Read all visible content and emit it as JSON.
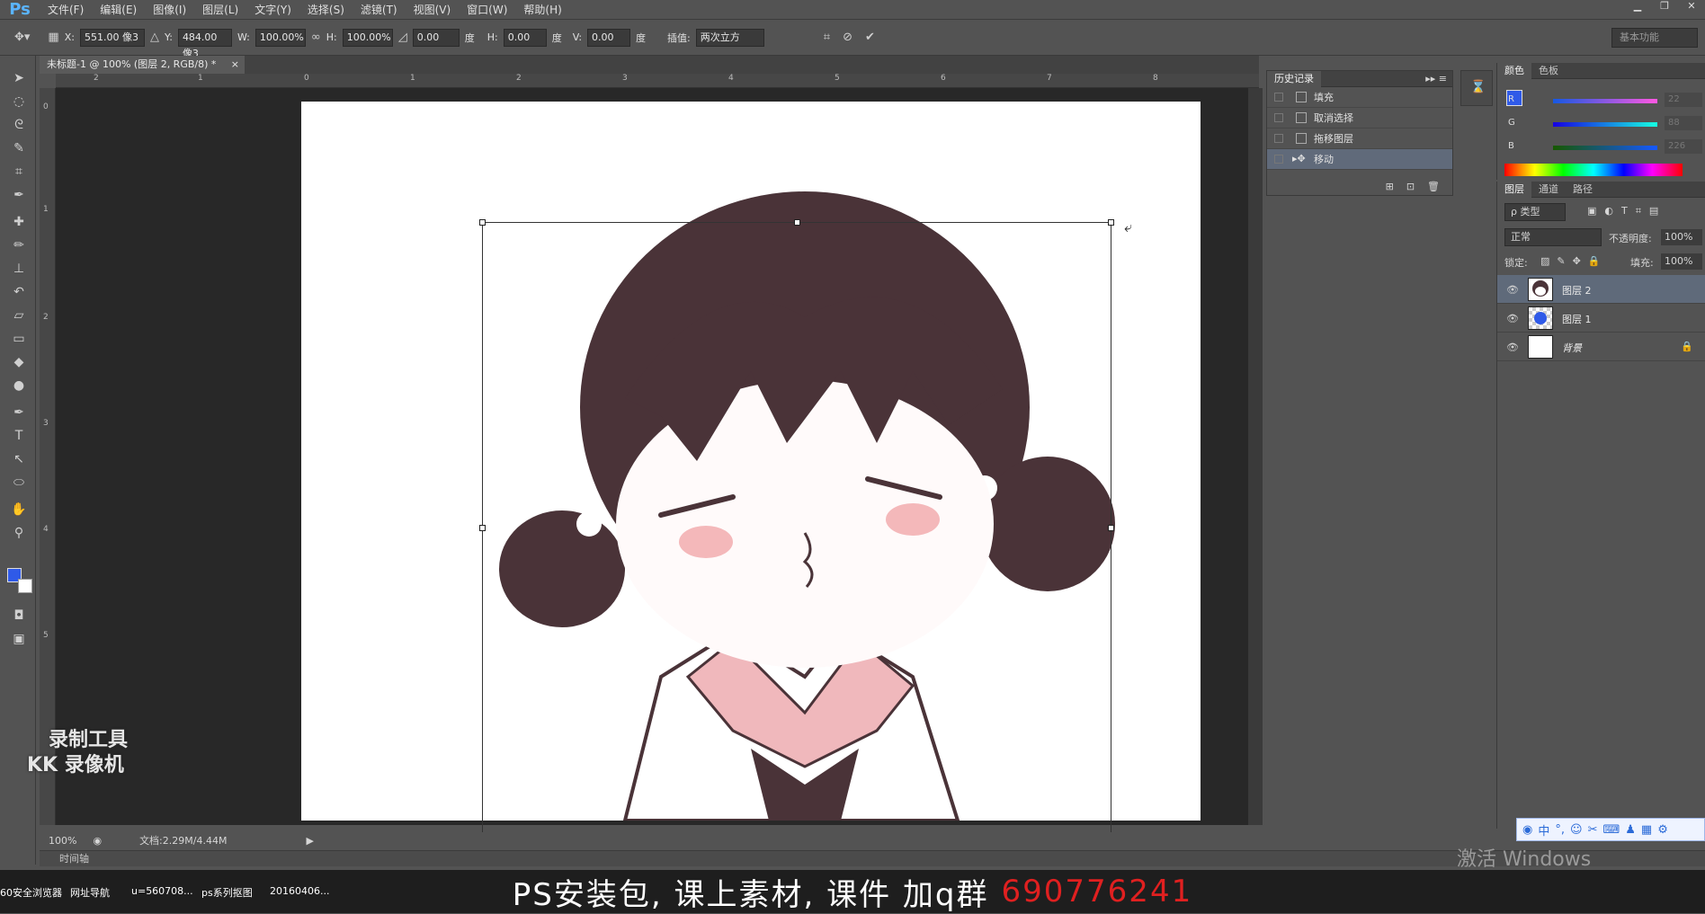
{
  "app": {
    "logo": "Ps"
  },
  "menu": [
    "文件(F)",
    "编辑(E)",
    "图像(I)",
    "图层(L)",
    "文字(Y)",
    "选择(S)",
    "滤镜(T)",
    "视图(V)",
    "窗口(W)",
    "帮助(H)"
  ],
  "window_controls": [
    "▁",
    "❐",
    "✕"
  ],
  "options": {
    "x_label": "X:",
    "x_value": "551.00 像3",
    "y_label": "Y:",
    "y_value": "484.00 像3",
    "w_label": "W:",
    "w_value": "100.00%",
    "h_label": "H:",
    "h_value": "100.00%",
    "angle_value": "0.00",
    "angle_unit": "度",
    "hskew_label": "H:",
    "hskew_value": "0.00",
    "hskew_unit": "度",
    "vskew_label": "V:",
    "vskew_value": "0.00",
    "vskew_unit": "度",
    "interp_label": "插值:",
    "interp_value": "两次立方",
    "workspace": "基本功能"
  },
  "document": {
    "tab_title": "未标题-1 @ 100% (图层 2, RGB/8) *",
    "zoom": "100%",
    "doc_info": "文档:2.29M/4.44M",
    "timeline_label": "时间轴",
    "ruler_h": [
      "2",
      "1",
      "0",
      "1",
      "2",
      "3",
      "4",
      "5",
      "6",
      "7",
      "8"
    ],
    "ruler_v": [
      "0",
      "1",
      "2",
      "3",
      "4",
      "5"
    ]
  },
  "history": {
    "tabs": [
      "历史记录"
    ],
    "items": [
      {
        "label": "填充"
      },
      {
        "label": "取消选择"
      },
      {
        "label": "拖移图层"
      },
      {
        "label": "移动"
      }
    ]
  },
  "color_panel": {
    "tabs": [
      "颜色",
      "色板"
    ],
    "r_label": "R",
    "r_value": "22",
    "g_label": "G",
    "g_value": "88",
    "b_label": "B",
    "b_value": "226",
    "foreground": "#2f5ae8",
    "background": "#ffffff"
  },
  "layers_panel": {
    "tabs": [
      "图层",
      "通道",
      "路径"
    ],
    "filter": "ρ 类型",
    "blend_mode": "正常",
    "opacity_label": "不透明度:",
    "opacity_value": "100%",
    "lock_label": "锁定:",
    "fill_label": "填充:",
    "fill_value": "100%",
    "layers": [
      {
        "name": "图层 2"
      },
      {
        "name": "图层 1"
      },
      {
        "name": "背景"
      }
    ]
  },
  "watermark": {
    "line1": "录制工具",
    "line2": "KK 录像机"
  },
  "banner": {
    "text": "PS安装包, 课上素材, 课件 加q群",
    "qq": "690776241"
  },
  "taskbar": {
    "items": [
      "60安全浏览器",
      "网址导航",
      "u=560708...",
      "ps系列抠图",
      "20160406..."
    ]
  },
  "windows_activation": "激活 Windows",
  "ime": {
    "label": "中"
  }
}
